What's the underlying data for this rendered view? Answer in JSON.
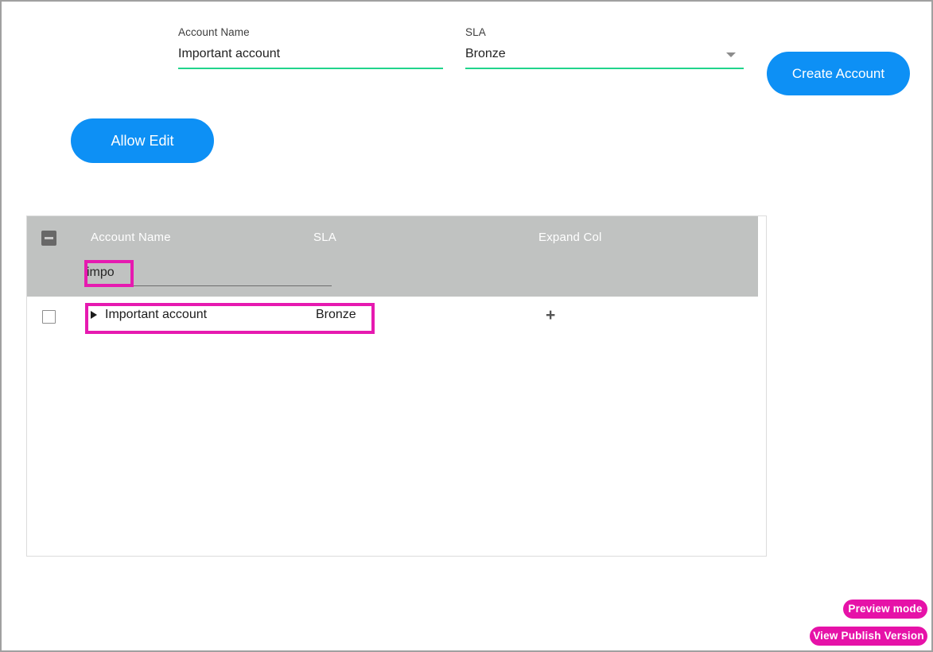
{
  "form": {
    "account_name": {
      "label": "Account Name",
      "value": "Important account",
      "placeholder": "Account Name"
    },
    "sla": {
      "label": "SLA",
      "value": "Bronze",
      "options": [
        "Bronze"
      ]
    },
    "create_button": "Create Account"
  },
  "toolbar": {
    "allow_edit_button": "Allow Edit"
  },
  "grid": {
    "columns": [
      {
        "key": "account_name",
        "label": "Account Name"
      },
      {
        "key": "sla",
        "label": "SLA"
      },
      {
        "key": "expand_col",
        "label": "Expand Col"
      }
    ],
    "filter": {
      "account_name_value": "impo",
      "account_name_placeholder": ""
    },
    "select_all_state": "indeterminate",
    "rows": [
      {
        "checked": false,
        "expand_toggle": "▶",
        "account_name": "Important account",
        "sla": "Bronze",
        "expand_col": "+"
      }
    ]
  },
  "badges": {
    "preview_mode": "Preview mode",
    "view_publish_version": "View Publish Version"
  },
  "colors": {
    "accent_blue": "#0d90f5",
    "underline_green": "#21d48c",
    "annotation_magenta": "#e61ab0",
    "badge_magenta": "#e612a8",
    "grid_header_gray": "#c0c2c1"
  }
}
